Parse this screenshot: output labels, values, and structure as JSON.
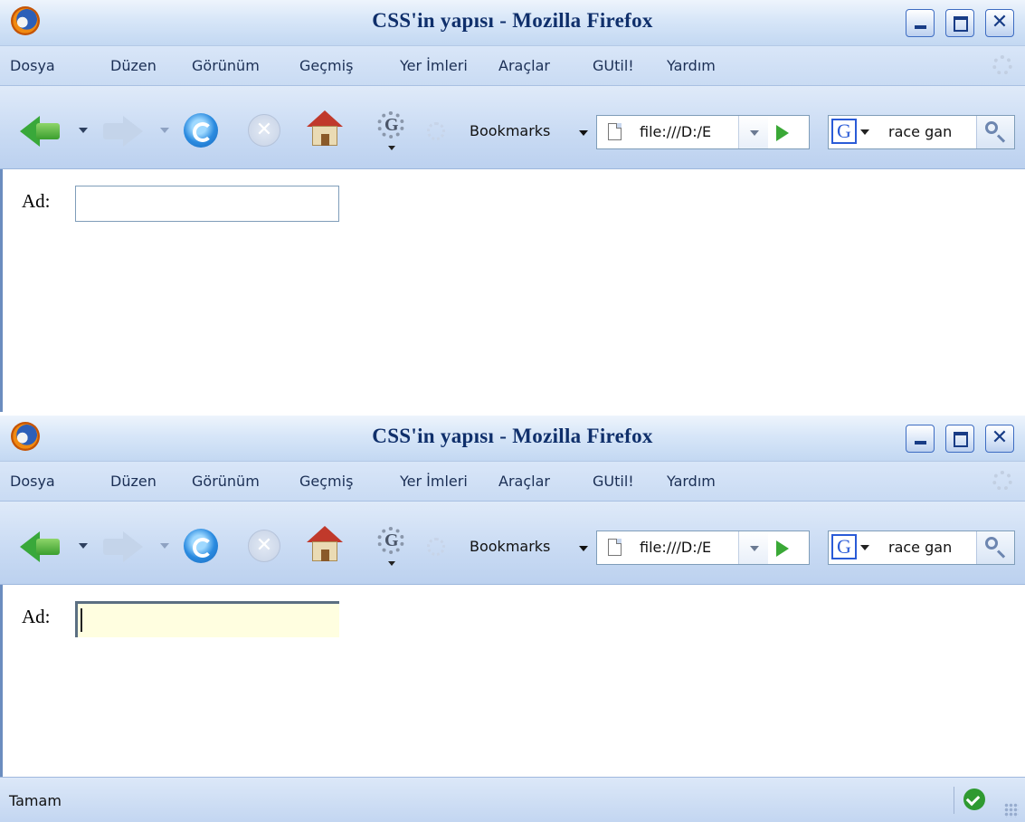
{
  "window": {
    "title": "CSS'in yapısı - Mozilla Firefox",
    "close_glyph": "✕",
    "stop_glyph": "✕"
  },
  "menu": {
    "items": [
      {
        "label": "Dosya"
      },
      {
        "label": "Düzen"
      },
      {
        "label": "Görünüm"
      },
      {
        "label": "Geçmiş"
      },
      {
        "label": "Yer İmleri"
      },
      {
        "label": "Araçlar"
      },
      {
        "label": "GUtil!"
      },
      {
        "label": "Yardım"
      }
    ]
  },
  "toolbar": {
    "bookmarks_label": "Bookmarks",
    "url_value": "file:///D:/E",
    "search_engine_glyph": "G",
    "search_value": "race gan"
  },
  "form": {
    "ad_label": "Ad:",
    "ad_value": ""
  },
  "status": {
    "text": "Tamam"
  },
  "colors": {
    "focus_background": "#fffee0",
    "titlebar_text": "#0f2f6b"
  }
}
